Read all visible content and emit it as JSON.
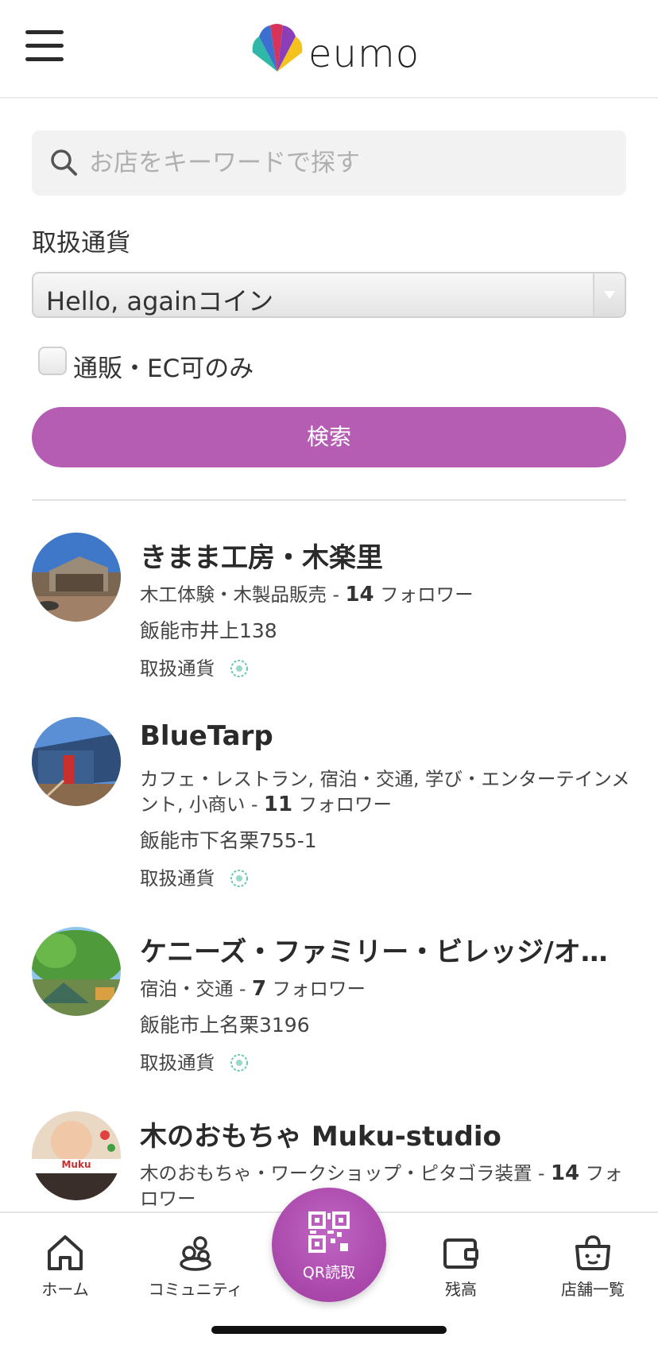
{
  "header": {
    "logo_text": "eumo"
  },
  "search": {
    "placeholder": "お店をキーワードで探す"
  },
  "filters": {
    "currency_label": "取扱通貨",
    "currency_value": "Hello, againコイン",
    "ec_only_label": "通販・EC可のみ",
    "ec_only_checked": false,
    "search_button": "検索"
  },
  "shops": [
    {
      "name": "きまま工房・木楽里",
      "category": "木工体験・木製品販売",
      "followers": "14",
      "followers_label": "フォロワー",
      "address": "飯能市井上138",
      "currency_label": "取扱通貨"
    },
    {
      "name": "BlueTarp",
      "category": "カフェ・レストラン, 宿泊・交通, 学び・エンターテインメント, 小商い",
      "followers": "11",
      "followers_label": "フォロワー",
      "address": "飯能市下名栗755-1",
      "currency_label": "取扱通貨"
    },
    {
      "name": "ケニーズ・ファミリー・ビレッジ/オートキャンプ場",
      "category": "宿泊・交通",
      "followers": "7",
      "followers_label": "フォロワー",
      "address": "飯能市上名栗3196",
      "currency_label": "取扱通貨"
    },
    {
      "name": "木のおもちゃ Muku-studio",
      "category": "木のおもちゃ・ワークショップ・ピタゴラ装置",
      "followers": "14",
      "followers_label": "フォロワー",
      "avatar_text": "Muku"
    }
  ],
  "nav": {
    "home": "ホーム",
    "community": "コミュニティ",
    "qr": "QR読取",
    "balance": "残高",
    "shops": "店舗一覧"
  },
  "colors": {
    "accent": "#b45db3"
  }
}
